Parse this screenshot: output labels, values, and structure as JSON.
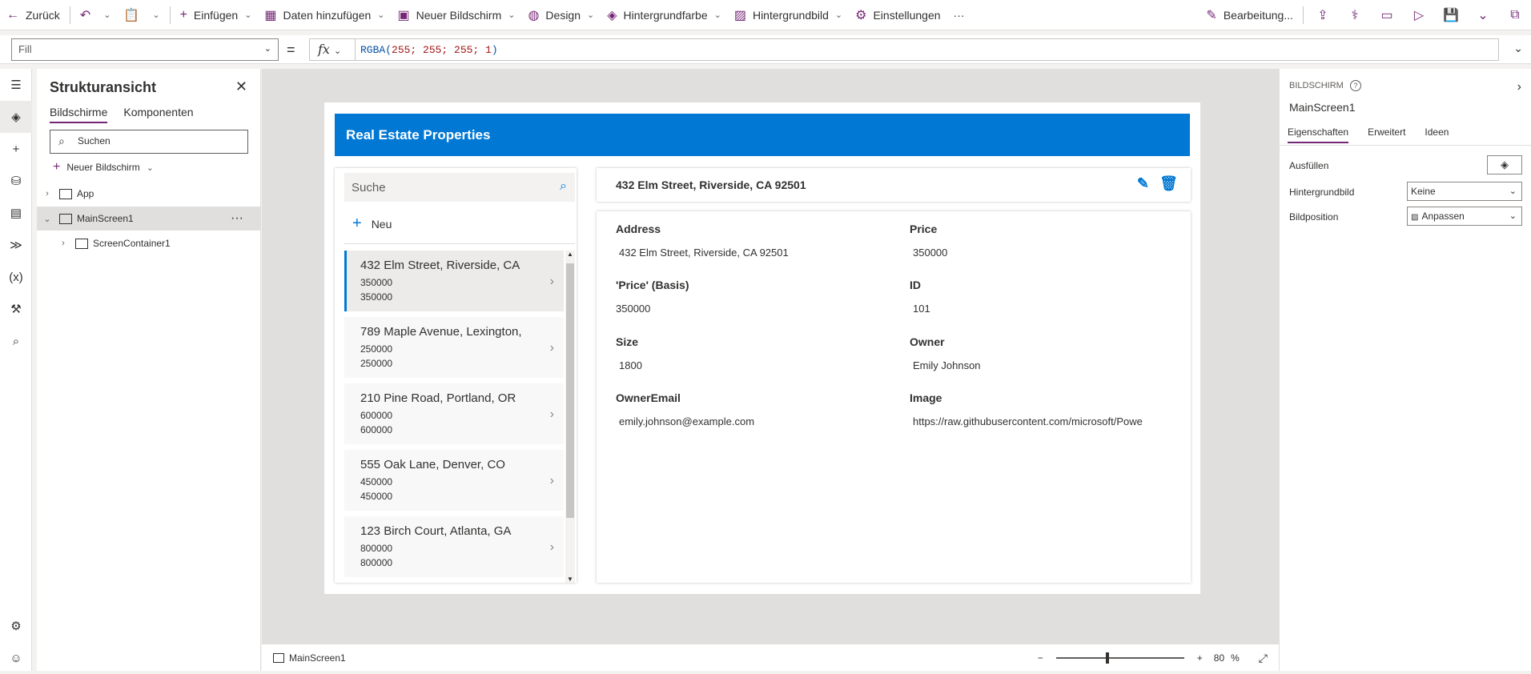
{
  "toolbar": {
    "back": "Zurück",
    "insert": "Einfügen",
    "add_data": "Daten hinzufügen",
    "new_screen": "Neuer Bildschirm",
    "design": "Design",
    "bg_color": "Hintergrundfarbe",
    "bg_image": "Hintergrundbild",
    "settings": "Einstellungen",
    "more": "···",
    "editing": "Bearbeitung..."
  },
  "formula_bar": {
    "property": "Fill",
    "equals": "=",
    "fx": "fx",
    "formula_fn": "RGBA(",
    "formula_args": "255; 255; 255; 1",
    "formula_close": ")"
  },
  "tree": {
    "title": "Strukturansicht",
    "tab_screens": "Bildschirme",
    "tab_components": "Komponenten",
    "search_placeholder": "Suchen",
    "new_screen": "Neuer Bildschirm",
    "items": [
      {
        "label": "App"
      },
      {
        "label": "MainScreen1"
      },
      {
        "label": "ScreenContainer1"
      }
    ]
  },
  "app": {
    "header": "Real Estate Properties",
    "search_placeholder": "Suche",
    "new_label": "Neu",
    "list": [
      {
        "title": "432 Elm Street, Riverside, CA",
        "sub1": "350000",
        "sub2": "350000"
      },
      {
        "title": "789 Maple Avenue, Lexington,",
        "sub1": "250000",
        "sub2": "250000"
      },
      {
        "title": "210 Pine Road, Portland, OR",
        "sub1": "600000",
        "sub2": "600000"
      },
      {
        "title": "555 Oak Lane, Denver, CO",
        "sub1": "450000",
        "sub2": "450000"
      },
      {
        "title": "123 Birch Court, Atlanta, GA",
        "sub1": "800000",
        "sub2": "800000"
      }
    ],
    "detail_title": "432 Elm Street, Riverside, CA 92501",
    "fields": {
      "address_label": "Address",
      "address_value": "432 Elm Street, Riverside, CA 92501",
      "price_label": "Price",
      "price_value": "350000",
      "price_basis_label": "'Price' (Basis)",
      "price_basis_value": "350000",
      "id_label": "ID",
      "id_value": "101",
      "size_label": "Size",
      "size_value": "1800",
      "owner_label": "Owner",
      "owner_value": "Emily Johnson",
      "owneremail_label": "OwnerEmail",
      "owneremail_value": "emily.johnson@example.com",
      "image_label": "Image",
      "image_value": "https://raw.githubusercontent.com/microsoft/Powe"
    }
  },
  "status": {
    "screen": "MainScreen1",
    "zoom_minus": "−",
    "zoom_plus": "+",
    "zoom_value": "80",
    "zoom_unit": "%",
    "zoom_level": 0.4
  },
  "props": {
    "category": "BILDSCHIRM",
    "name": "MainScreen1",
    "tab_props": "Eigenschaften",
    "tab_advanced": "Erweitert",
    "tab_ideas": "Ideen",
    "fill_label": "Ausfüllen",
    "bg_image_label": "Hintergrundbild",
    "bg_image_value": "Keine",
    "img_pos_label": "Bildposition",
    "img_pos_value": "Anpassen"
  }
}
